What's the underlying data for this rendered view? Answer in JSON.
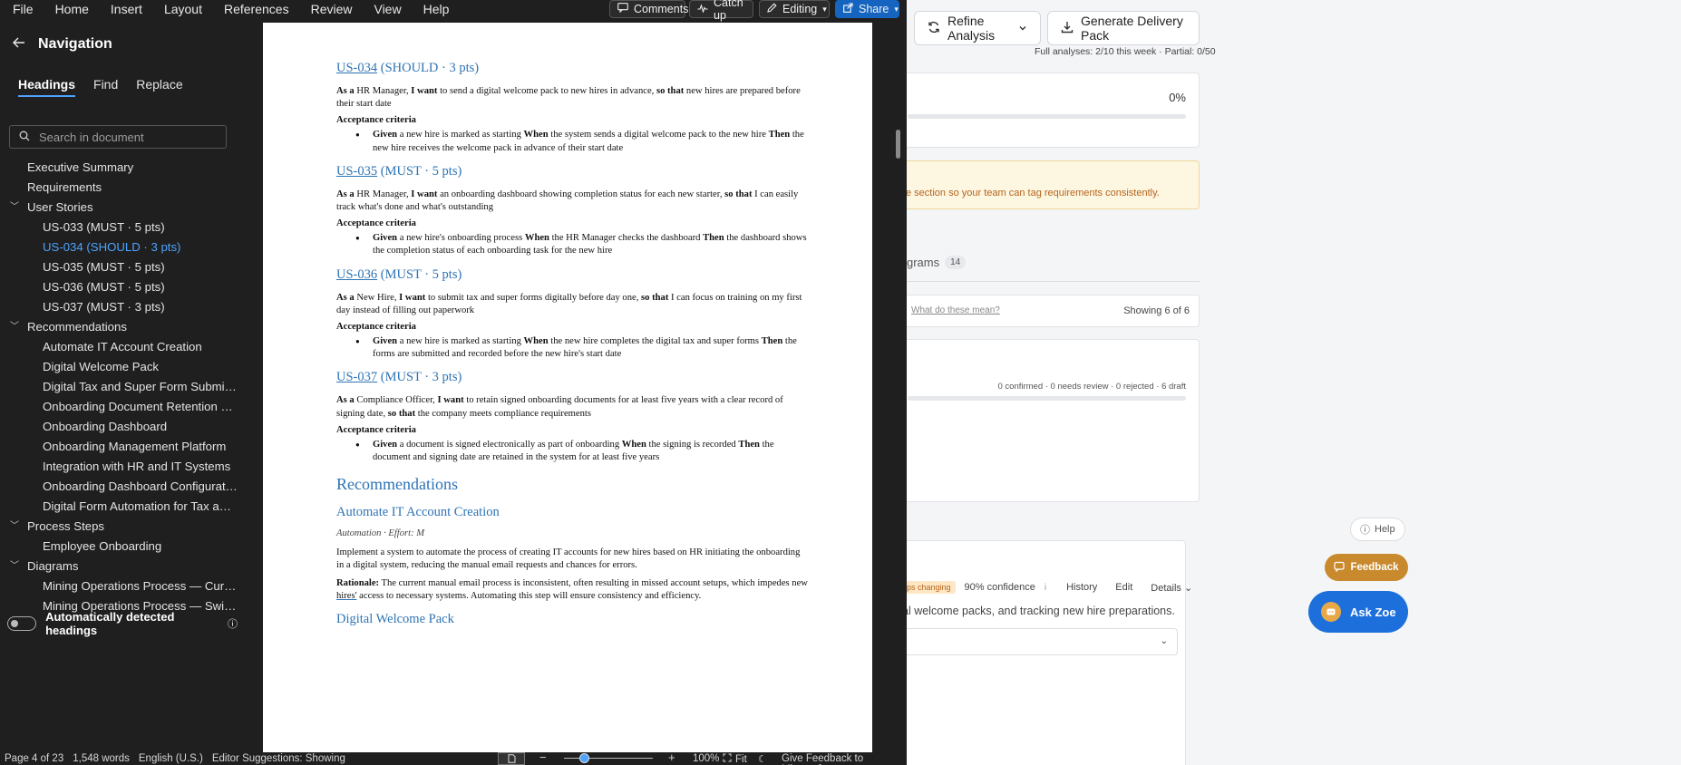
{
  "menu": [
    "File",
    "Home",
    "Insert",
    "Layout",
    "References",
    "Review",
    "View",
    "Help"
  ],
  "toolbar": {
    "comments": "Comments",
    "catchup": "Catch up",
    "editing": "Editing",
    "share": "Share"
  },
  "nav": {
    "title": "Navigation",
    "tabs": [
      "Headings",
      "Find",
      "Replace"
    ],
    "search_placeholder": "Search in document",
    "items": [
      {
        "label": "Executive Summary",
        "level": 1
      },
      {
        "label": "Requirements",
        "level": 1
      },
      {
        "label": "User Stories",
        "level": 1,
        "collapsible": true
      },
      {
        "label": "US-033  (MUST · 5 pts)",
        "level": 2
      },
      {
        "label": "US-034  (SHOULD · 3 pts)",
        "level": 2,
        "selected": true
      },
      {
        "label": "US-035  (MUST · 5 pts)",
        "level": 2
      },
      {
        "label": "US-036  (MUST · 5 pts)",
        "level": 2
      },
      {
        "label": "US-037  (MUST · 3 pts)",
        "level": 2
      },
      {
        "label": "Recommendations",
        "level": 1,
        "collapsible": true
      },
      {
        "label": "Automate IT Account Creation",
        "level": 2
      },
      {
        "label": "Digital Welcome Pack",
        "level": 2
      },
      {
        "label": "Digital Tax and Super Form Submissi...",
        "level": 2
      },
      {
        "label": "Onboarding Document Retention an...",
        "level": 2
      },
      {
        "label": "Onboarding Dashboard",
        "level": 2
      },
      {
        "label": "Onboarding Management Platform",
        "level": 2
      },
      {
        "label": "Integration with HR and IT Systems",
        "level": 2
      },
      {
        "label": "Onboarding Dashboard Configuration",
        "level": 2
      },
      {
        "label": "Digital Form Automation for Tax and...",
        "level": 2
      },
      {
        "label": "Process Steps",
        "level": 1,
        "collapsible": true
      },
      {
        "label": "Employee Onboarding",
        "level": 2
      },
      {
        "label": "Diagrams",
        "level": 1,
        "collapsible": true
      },
      {
        "label": "Mining Operations Process — Curre...",
        "level": 2
      },
      {
        "label": "Mining Operations Process — Swiml...",
        "level": 2
      }
    ],
    "auto_headings": "Automatically detected headings"
  },
  "doc": {
    "stories": [
      {
        "id": "US-034",
        "tag": "  (SHOULD · 3 pts)",
        "as": "HR Manager,",
        "want": " to send a digital welcome pack to new hires in advance,",
        "so": " new hires are prepared before their start date",
        "given": " a new hire is marked as starting ",
        "when": " the system sends a digital welcome pack to the new hire ",
        "then": " the new hire receives the welcome pack in advance of their start date"
      },
      {
        "id": "US-035",
        "tag": "  (MUST · 5 pts)",
        "as": "HR Manager,",
        "want": " an onboarding dashboard showing completion status for each new starter,",
        "so": " I can easily track what's done and what's outstanding",
        "given": " a new hire's onboarding process ",
        "when": " the HR Manager checks the dashboard ",
        "then": " the dashboard shows the completion status of each onboarding task for the new hire"
      },
      {
        "id": "US-036",
        "tag": "  (MUST · 5 pts)",
        "as": "New Hire,",
        "want": " to submit tax and super forms digitally before day one,",
        "so": " I can focus on training on my first day instead of filling out paperwork",
        "given": " a new hire is marked as starting ",
        "when": " the new hire completes the digital tax and super forms ",
        "then": " the forms are submitted and recorded before the new hire's start date"
      },
      {
        "id": "US-037",
        "tag": "  (MUST · 3 pts)",
        "as": "Compliance Officer,",
        "want": " to retain signed onboarding documents for at least five years with a clear record of signing date,",
        "so": " the company meets compliance requirements",
        "given": " a document is signed electronically as part of onboarding ",
        "when": " the signing is recorded ",
        "then": " the document and signing date are retained in the system for at least five years"
      }
    ],
    "kw": {
      "as": "As a ",
      "want": "I want",
      "so": "so that",
      "ac": "Acceptance criteria",
      "given": "Given",
      "when": "When",
      "then": "Then"
    },
    "rec_heading": "Recommendations",
    "rec1_title": "Automate IT Account Creation",
    "rec1_meta": "Automation · Effort: M",
    "rec1_body": "Implement a system to automate the process of creating IT accounts for new hires based on HR initiating the onboarding in a digital system, reducing the manual email requests and chances for errors.",
    "rationale_label": "Rationale:",
    "rec1_rationale_a": " The current manual email process is inconsistent, often resulting in missed account setups, which impedes new ",
    "rec1_rationale_hires": "hires'",
    "rec1_rationale_b": " access to necessary systems. Automating this step will ensure consistency and efficiency.",
    "rec2_title": "Digital Welcome Pack"
  },
  "status": {
    "page": "Page 4 of 23",
    "words": "1,548 words",
    "lang": "English (U.S.)",
    "suggestions": "Editor Suggestions: Showing",
    "zoom": "100%",
    "fit": "Fit",
    "feedback": "Give Feedback to Microsoft"
  },
  "webapp": {
    "refine": "Refine Analysis",
    "delivery": "Generate Delivery Pack",
    "quota": "Full analyses: 2/10 this week · Partial: 0/50",
    "progress": "0%",
    "alert": "e section so your team can tag requirements consistently.",
    "tab_diagrams": "grams",
    "tab_diagrams_count": "14",
    "what_mean": "What do these mean?",
    "showing": "Showing 6 of 6",
    "counts": "0 confirmed · 0 needs review · 0 rejected · 6 draft",
    "help": "Help",
    "feedback": "Feedback",
    "askzoe": "Ask Zoe",
    "changing": "ps changing",
    "confidence": "90% confidence",
    "history": "History",
    "edit": "Edit",
    "details": "Details",
    "desc": "al welcome packs, and tracking new hire preparations."
  }
}
